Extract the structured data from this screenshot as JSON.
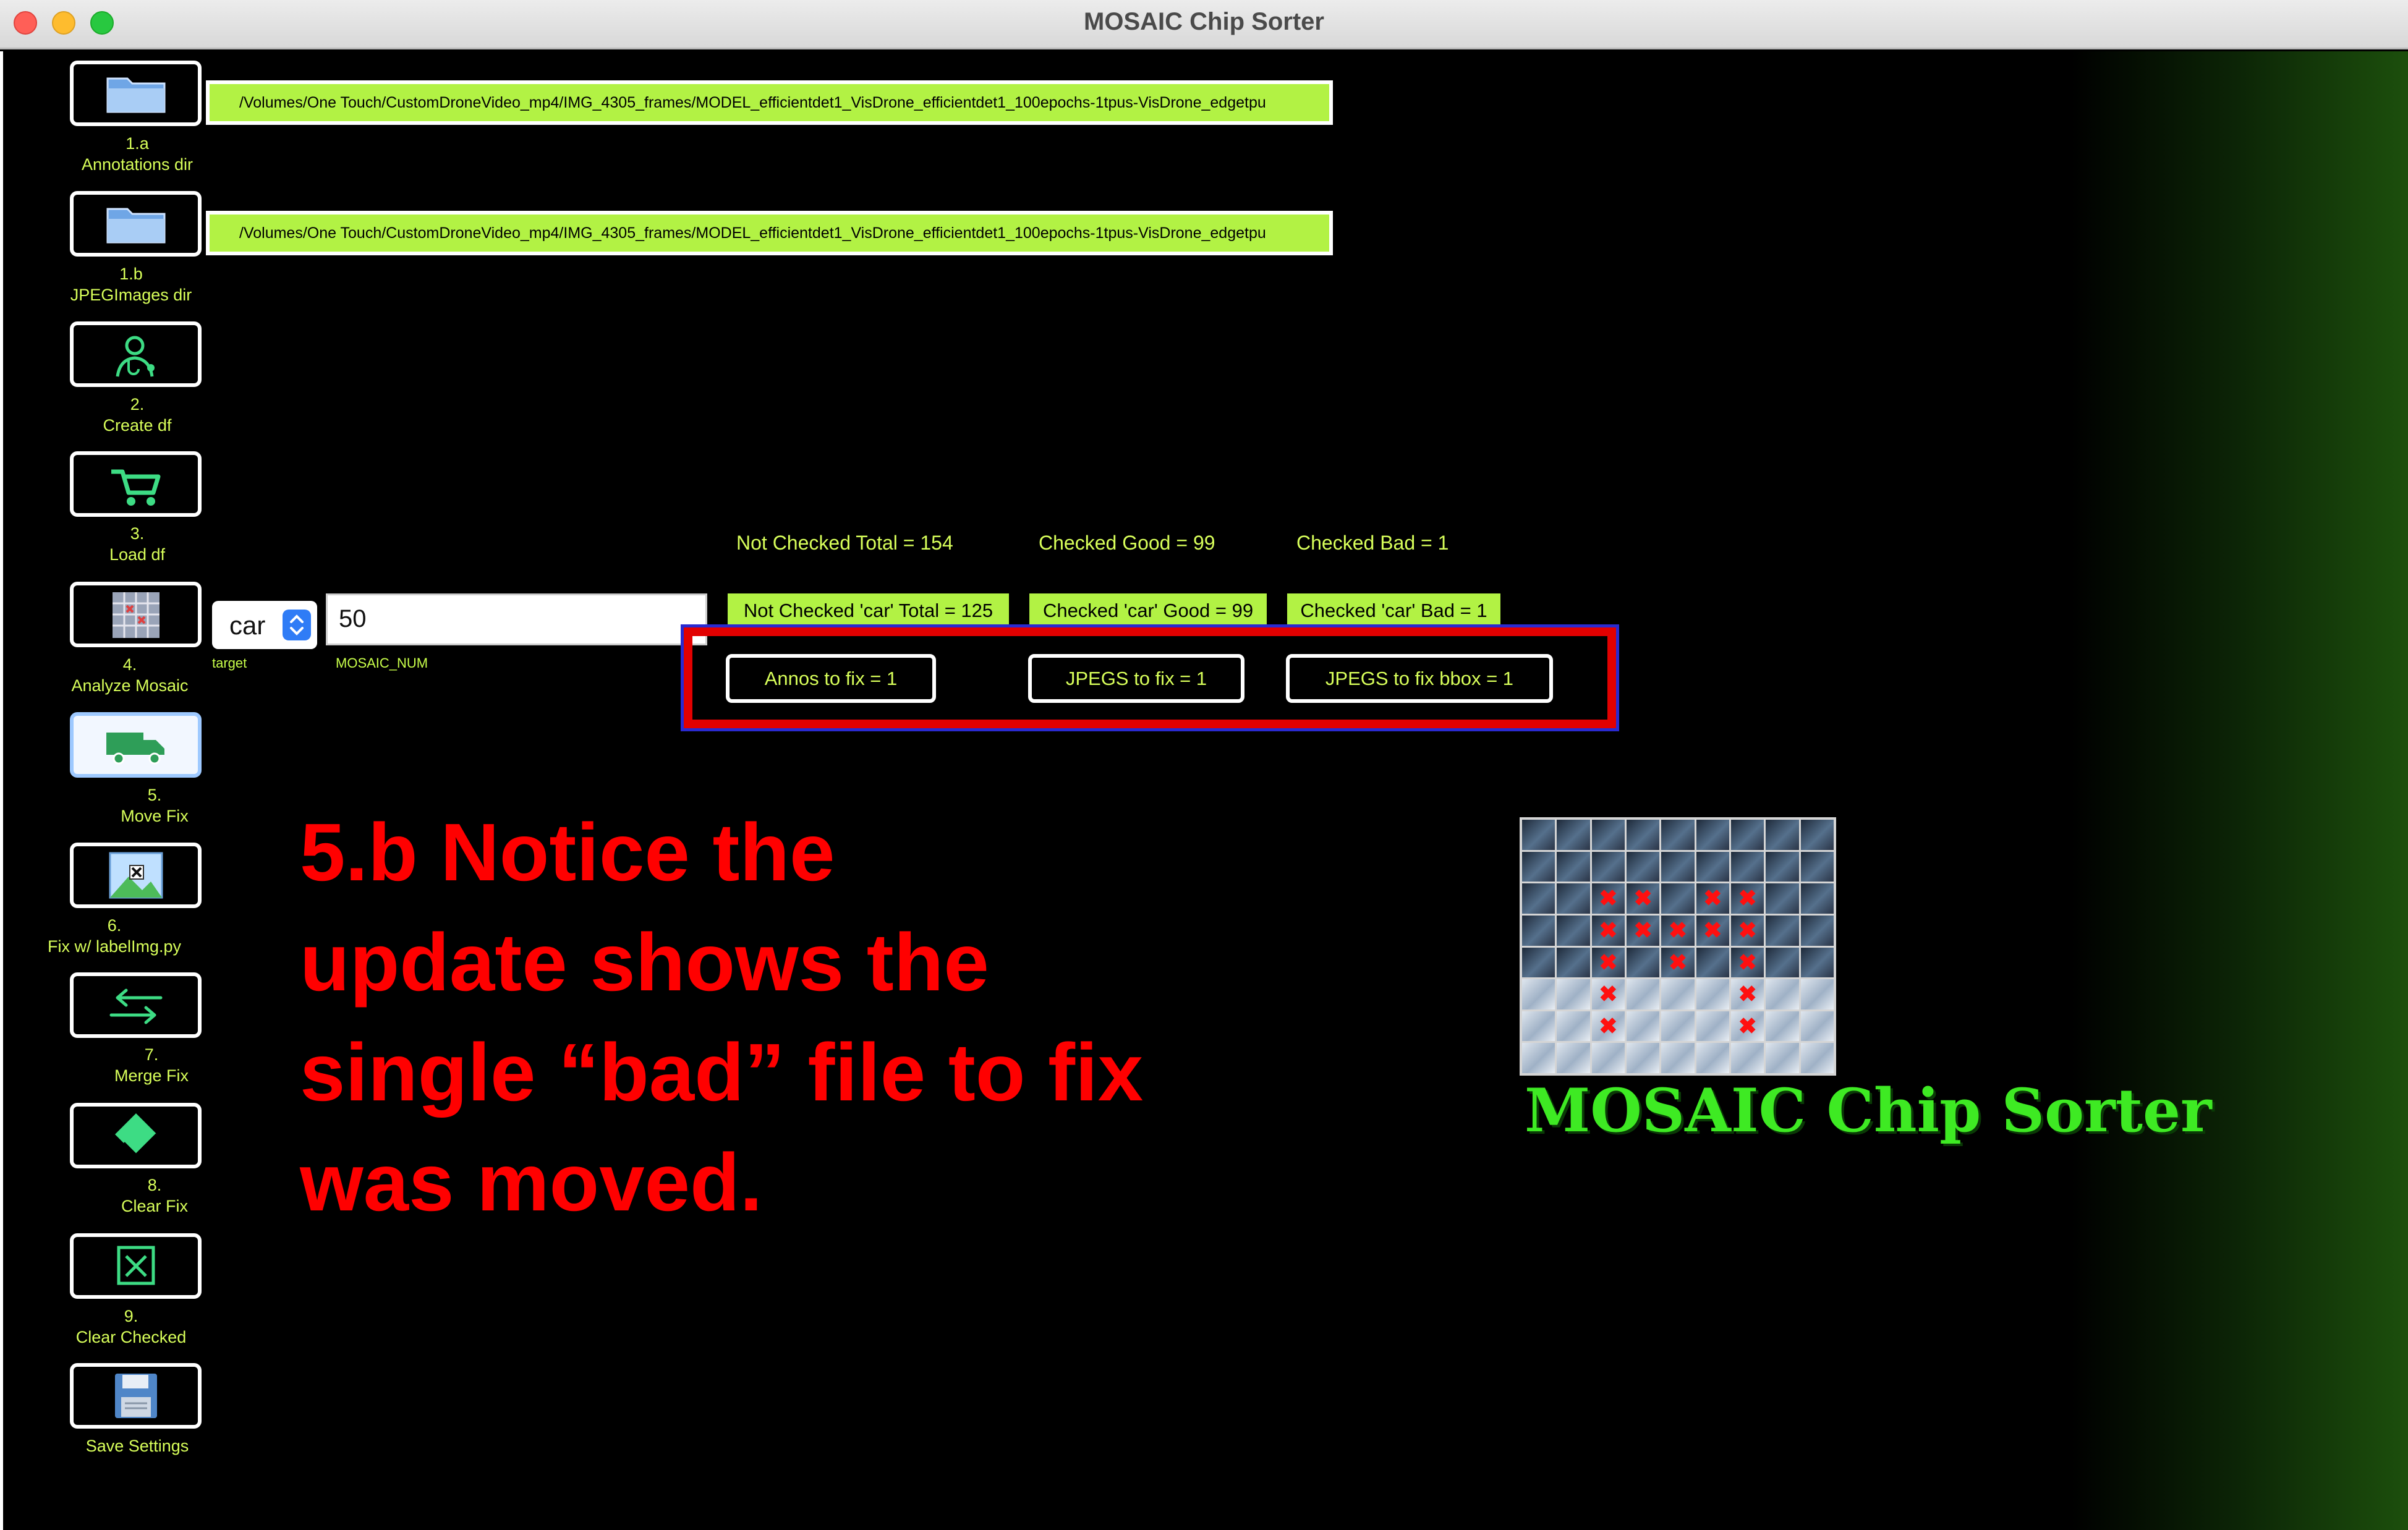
{
  "window": {
    "title": "MOSAIC Chip Sorter"
  },
  "sidebar": {
    "items": [
      {
        "id": "annotations-dir",
        "num": "1.a",
        "label": "Annotations dir",
        "icon": "folder-icon"
      },
      {
        "id": "jpegimages-dir",
        "num": "1.b",
        "label": "JPEGImages dir",
        "icon": "folder-icon"
      },
      {
        "id": "create-df",
        "num": "2.",
        "label": "Create df",
        "icon": "doctor-icon"
      },
      {
        "id": "load-df",
        "num": "3.",
        "label": "Load df",
        "icon": "cart-icon"
      },
      {
        "id": "analyze-mosaic",
        "num": "4.",
        "label": "Analyze Mosaic",
        "icon": "mosaic-icon"
      },
      {
        "id": "move-fix",
        "num": "5.",
        "label": "Move Fix",
        "icon": "truck-icon"
      },
      {
        "id": "fix-labelimg",
        "num": "6.",
        "label": "Fix w/ labelImg.py",
        "icon": "image-edit-icon"
      },
      {
        "id": "merge-fix",
        "num": "7.",
        "label": "Merge Fix",
        "icon": "swap-arrows-icon"
      },
      {
        "id": "clear-fix",
        "num": "8.",
        "label": "Clear Fix",
        "icon": "eraser-icon"
      },
      {
        "id": "clear-checked",
        "num": "9.",
        "label": "Clear Checked",
        "icon": "x-box-icon"
      },
      {
        "id": "save-settings",
        "num": "",
        "label": "Save Settings",
        "icon": "floppy-disk-icon"
      }
    ]
  },
  "paths": {
    "annotations": "/Volumes/One Touch/CustomDroneVideo_mp4/IMG_4305_frames/MODEL_efficientdet1_VisDrone_efficientdet1_100epochs-1tpus-VisDrone_edgetpu",
    "jpegimages": "/Volumes/One Touch/CustomDroneVideo_mp4/IMG_4305_frames/MODEL_efficientdet1_VisDrone_efficientdet1_100epochs-1tpus-VisDrone_edgetpu"
  },
  "controls": {
    "target_value": "car",
    "target_label": "target",
    "mosaic_num_value": "50",
    "mosaic_num_label": "MOSAIC_NUM"
  },
  "stats": {
    "not_checked_total": "Not Checked Total = 154",
    "checked_good": "Checked Good = 99",
    "checked_bad": "Checked Bad = 1",
    "not_checked_car": "Not Checked 'car' Total = 125",
    "checked_car_good": "Checked 'car' Good = 99",
    "checked_car_bad": "Checked 'car' Bad = 1"
  },
  "fix": {
    "annos": "Annos to fix = 1",
    "jpegs": "JPEGS to fix = 1",
    "jpegs_bbox": "JPEGS to fix bbox = 1"
  },
  "annotation": {
    "lines": [
      "5.b  Notice the",
      "update shows the",
      "single “bad” file to fix",
      "was moved."
    ]
  },
  "logo": {
    "text": "MOSAIC Chip Sorter"
  },
  "colors": {
    "accent_green": "#b2f244",
    "label_green": "#d8ff5a",
    "annotation_red": "#ff0000",
    "logo_green": "#3eea23"
  }
}
